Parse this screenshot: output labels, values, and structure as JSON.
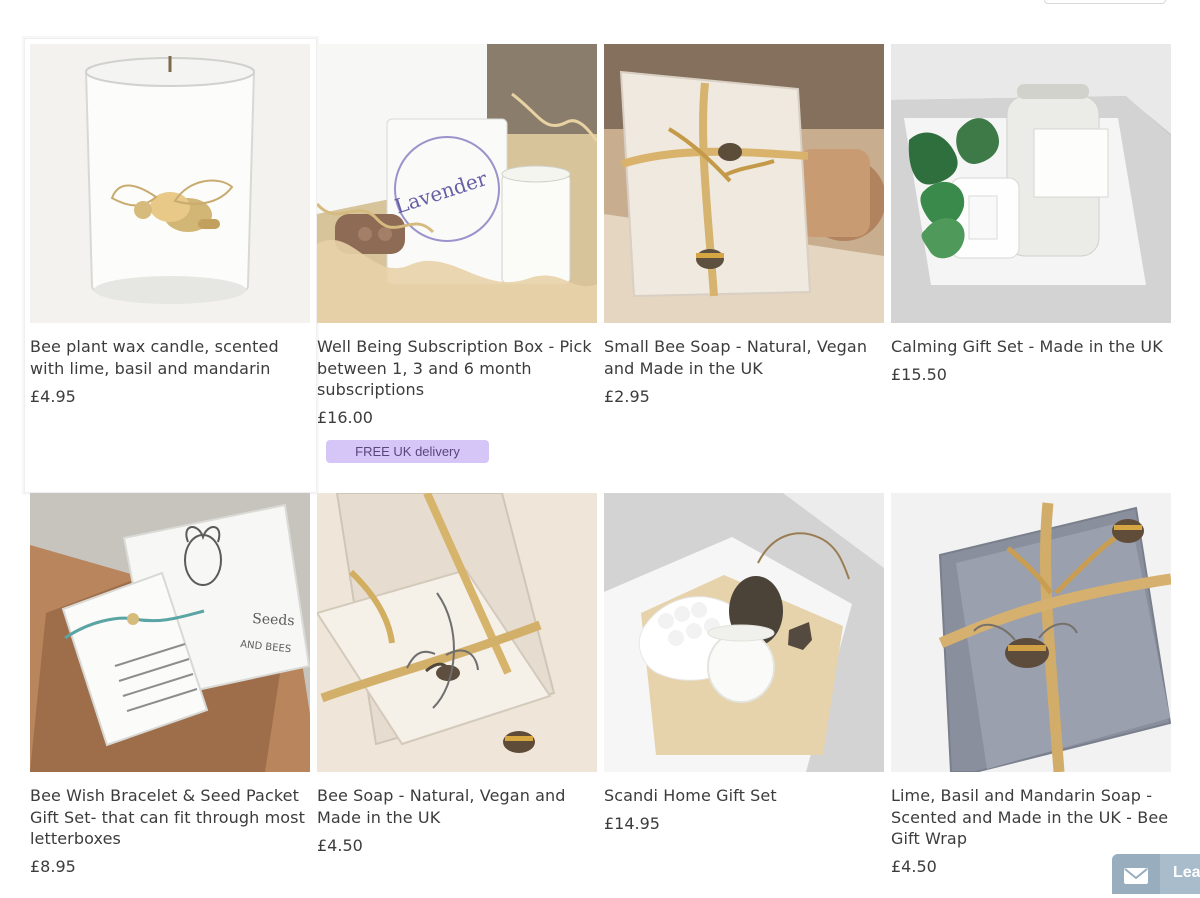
{
  "products": [
    {
      "title": "Bee plant wax candle, scented with lime, basil and mandarin",
      "price": "£4.95"
    },
    {
      "title": "Well Being Subscription Box - Pick between 1, 3 and 6 month subscriptions",
      "price": "£16.00",
      "badge": "FREE UK delivery"
    },
    {
      "title": "Small Bee Soap - Natural, Vegan and Made in the UK",
      "price": "£2.95"
    },
    {
      "title": "Calming Gift Set - Made in the UK",
      "price": "£15.50"
    },
    {
      "title": "Bee Wish Bracelet & Seed Packet Gift Set- that can fit through most letterboxes",
      "price": "£8.95"
    },
    {
      "title": "Bee Soap - Natural, Vegan and Made in the UK",
      "price": "£4.50"
    },
    {
      "title": "Scandi Home Gift Set",
      "price": "£14.95"
    },
    {
      "title": "Lime, Basil and Mandarin Soap - Scented and Made in the UK - Bee Gift Wrap",
      "price": "£4.50"
    }
  ],
  "image_text": {
    "lavender_card": "Lavender",
    "seeds_card": "Seeds",
    "bees_card": "AND BEES"
  },
  "chat_widget": {
    "label": "Lea"
  }
}
